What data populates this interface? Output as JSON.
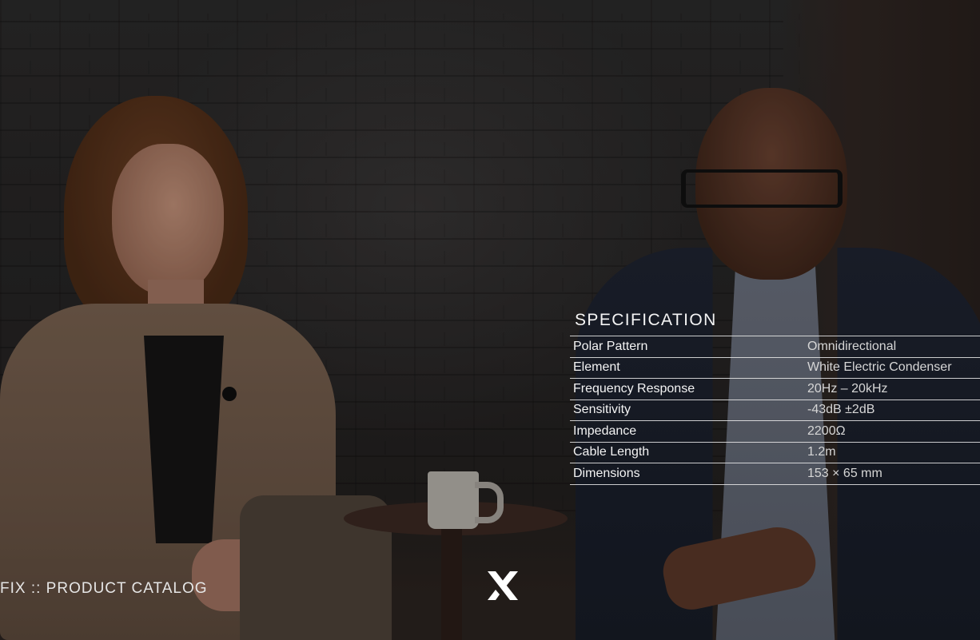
{
  "spec": {
    "title": "SPECIFICATION",
    "rows": [
      {
        "label": "Polar Pattern",
        "value": "Omnidirectional"
      },
      {
        "label": "Element",
        "value": "White Electric Condenser"
      },
      {
        "label": "Frequency Response",
        "value": "20Hz – 20kHz"
      },
      {
        "label": "Sensitivity",
        "value": "-43dB ±2dB"
      },
      {
        "label": "Impedance",
        "value": "2200Ω"
      },
      {
        "label": "Cable Length",
        "value": "1.2m"
      },
      {
        "label": "Dimensions",
        "value": "153 × 65 mm"
      }
    ]
  },
  "footer": {
    "catalog_label": "FIX :: PRODUCT CATALOG",
    "logo_icon": "x-logo-icon"
  },
  "colors": {
    "text": "#f2f2f2",
    "rule": "#ebebeb",
    "background": "#1b1716"
  }
}
